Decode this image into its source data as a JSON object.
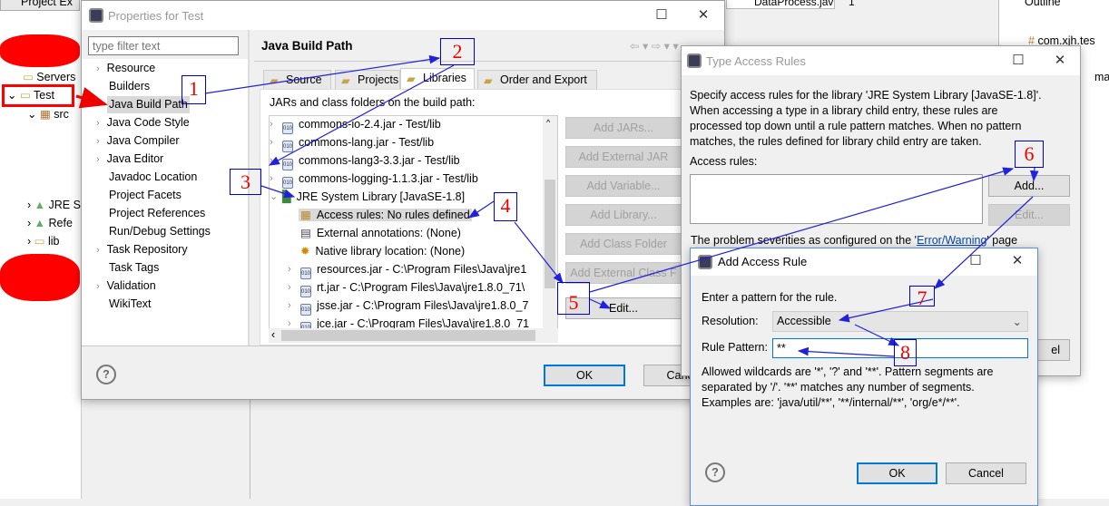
{
  "background": {
    "explorer_tab": "Project Ex",
    "explorer_items": [
      {
        "label": "Servers"
      },
      {
        "label": "Test"
      },
      {
        "label": "src"
      },
      {
        "label": "JRE S"
      },
      {
        "label": "Refe"
      },
      {
        "label": "lib"
      }
    ],
    "editor_tab": "DataProcess.jav",
    "editor_tab2": "1",
    "outline_tab": "Outline",
    "outline_items": [
      "com.xjh.tes",
      "main(S"
    ]
  },
  "properties": {
    "title": "Properties for Test",
    "filter_placeholder": "type filter text",
    "nav": [
      {
        "label": "Resource",
        "exp": true
      },
      {
        "label": "Builders",
        "exp": false
      },
      {
        "label": "Java Build Path",
        "exp": false,
        "selected": true
      },
      {
        "label": "Java Code Style",
        "exp": true
      },
      {
        "label": "Java Compiler",
        "exp": true
      },
      {
        "label": "Java Editor",
        "exp": true
      },
      {
        "label": "Javadoc Location",
        "exp": false
      },
      {
        "label": "Project Facets",
        "exp": false
      },
      {
        "label": "Project References",
        "exp": false
      },
      {
        "label": "Run/Debug Settings",
        "exp": false
      },
      {
        "label": "Task Repository",
        "exp": true
      },
      {
        "label": "Task Tags",
        "exp": false
      },
      {
        "label": "Validation",
        "exp": true
      },
      {
        "label": "WikiText",
        "exp": false
      }
    ],
    "page_title": "Java Build Path",
    "tabs": [
      {
        "label": "Source"
      },
      {
        "label": "Projects"
      },
      {
        "label": "Libraries",
        "selected": true
      },
      {
        "label": "Order and Export"
      }
    ],
    "list_label": "JARs and class folders on the build path:",
    "entries": [
      {
        "label": "commons-io-2.4.jar - Test/lib",
        "level": 0,
        "icon": "jar"
      },
      {
        "label": "commons-lang.jar - Test/lib",
        "level": 0,
        "icon": "jar"
      },
      {
        "label": "commons-lang3-3.3.jar - Test/lib",
        "level": 0,
        "icon": "jar"
      },
      {
        "label": "commons-logging-1.1.3.jar - Test/lib",
        "level": 0,
        "icon": "jar"
      },
      {
        "label": "JRE System Library [JavaSE-1.8]",
        "level": 0,
        "icon": "library",
        "expanded": true
      },
      {
        "label": "Access rules: No rules defined",
        "level": 1,
        "icon": "access-rules",
        "selected": true
      },
      {
        "label": "External annotations: (None)",
        "level": 1,
        "icon": "annotations"
      },
      {
        "label": "Native library location: (None)",
        "level": 1,
        "icon": "native"
      },
      {
        "label": "resources.jar - C:\\Program Files\\Java\\jre1",
        "level": 1,
        "icon": "jar",
        "exp": true
      },
      {
        "label": "rt.jar - C:\\Program Files\\Java\\jre1.8.0_71\\",
        "level": 1,
        "icon": "jar",
        "exp": true
      },
      {
        "label": "jsse.jar - C:\\Program Files\\Java\\jre1.8.0_7",
        "level": 1,
        "icon": "jar",
        "exp": true
      },
      {
        "label": "jce.jar - C:\\Program Files\\Java\\jre1.8.0_71",
        "level": 1,
        "icon": "jar",
        "exp": true
      }
    ],
    "buttons": [
      {
        "label": "Add JARs...",
        "disabled": true
      },
      {
        "label": "Add External JAR",
        "disabled": true
      },
      {
        "label": "Add Variable...",
        "disabled": true
      },
      {
        "label": "Add Library...",
        "disabled": true
      },
      {
        "label": "Add Class Folder",
        "disabled": true
      },
      {
        "label": "Add External Class F",
        "disabled": true
      }
    ],
    "edit_label": "Edit...",
    "ok_label": "OK",
    "cancel_label": "Cancel"
  },
  "type_access": {
    "title": "Type Access Rules",
    "description": [
      "Specify access rules for the library 'JRE System Library [JavaSE-1.8]'.",
      "When accessing a type in a library child entry, these rules are",
      "processed top down until a rule pattern matches. When no pattern",
      "matches, the rules defined for library child entry are taken."
    ],
    "rules_label": "Access rules:",
    "add_label": "Add...",
    "edit_label": "Edit...",
    "severity_prefix": "The problem severities as configured on the '",
    "severity_link": "Error/Warning",
    "severity_suffix": "' page",
    "cancel_partial": "el"
  },
  "add_rule": {
    "title": "Add Access Rule",
    "prompt": "Enter a pattern for the rule.",
    "resolution_label": "Resolution:",
    "resolution_value": "Accessible",
    "pattern_label": "Rule Pattern:",
    "pattern_value": "**",
    "help": [
      "Allowed wildcards are '*', '?' and '**'. Pattern segments are",
      "separated by '/'. '**' matches any number of segments.",
      "Examples are: 'java/util/**', '**/internal/**', 'org/e*/**'."
    ],
    "ok_label": "OK",
    "cancel_label": "Cancel"
  },
  "annotations": [
    "1",
    "2",
    "3",
    "4",
    "5",
    "6",
    "7",
    "8"
  ],
  "colors": {
    "annotation_box": "#0000cc",
    "annotation_number": "#ee0000",
    "arrow": "#2020dd",
    "highlight": "#ff0000",
    "focus": "#0078d7"
  }
}
